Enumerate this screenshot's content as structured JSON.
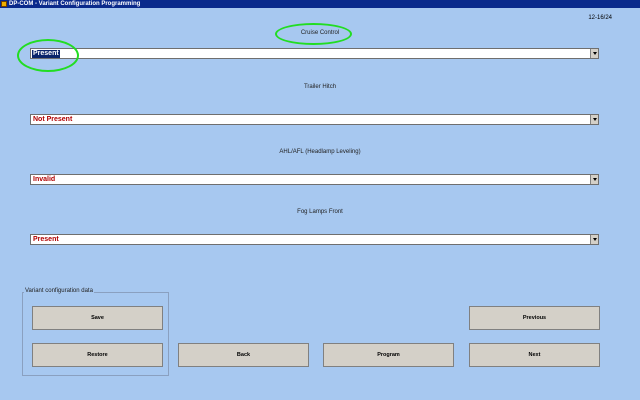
{
  "window": {
    "title": "DP-COM - Variant Configuration Programming"
  },
  "date": "12-16/24",
  "fields": [
    {
      "label": "Cruise Control",
      "value": "Present"
    },
    {
      "label": "Trailer Hitch",
      "value": "Not Present"
    },
    {
      "label": "AHL/AFL (Headlamp Leveling)",
      "value": "Invalid"
    },
    {
      "label": "Fog Lamps Front",
      "value": "Present"
    }
  ],
  "group": {
    "title": "Variant configuration data"
  },
  "buttons": {
    "save": "Save",
    "restore": "Restore",
    "back": "Back",
    "program": "Program",
    "previous": "Previous",
    "next": "Next"
  },
  "colors": {
    "background": "#a7c8f0",
    "value_text": "#b00000",
    "highlight": "#22dd22"
  }
}
